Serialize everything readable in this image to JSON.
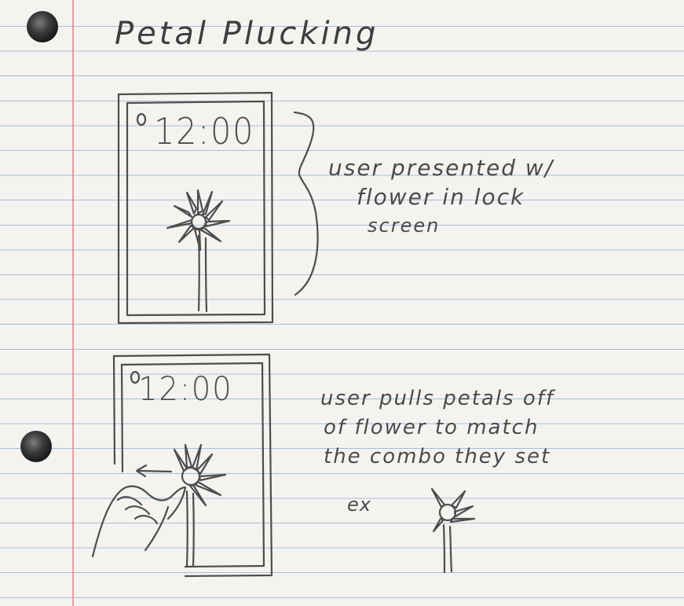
{
  "title": "Petal Plucking",
  "frame1": {
    "clock": "12:00",
    "note": [
      "user presented w/",
      "flower in lock",
      "screen"
    ]
  },
  "frame2": {
    "clock": "12:00",
    "note": [
      "user pulls petals off",
      "of flower to match",
      "the combo they set"
    ],
    "example_label": "ex"
  },
  "colors": {
    "paper": "#f5f3f0",
    "rule_line": "#6096c4",
    "margin_line": "#e28088",
    "pencil": "#4d4d4d"
  },
  "icons": [
    "binder-hole",
    "flower-icon",
    "hand-icon",
    "swipe-arrow-icon"
  ]
}
